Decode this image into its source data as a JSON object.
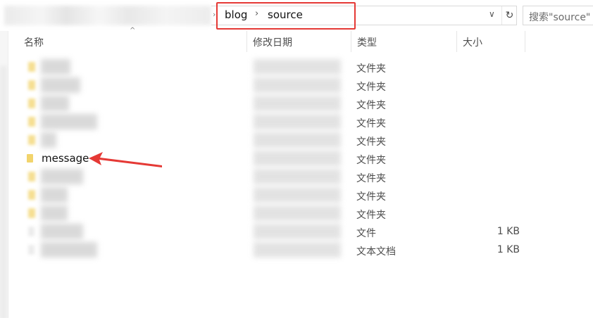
{
  "address_bar": {
    "path": [
      "blog",
      "source"
    ],
    "chevron": "›",
    "dropdown_icon": "chevron-down-icon",
    "refresh_icon": "refresh-icon"
  },
  "search": {
    "placeholder": "搜索\"source\""
  },
  "columns": {
    "name": "名称",
    "date": "修改日期",
    "type": "类型",
    "size": "大小"
  },
  "rows": [
    {
      "name": "",
      "type": "文件夹",
      "size": ""
    },
    {
      "name": "",
      "type": "文件夹",
      "size": ""
    },
    {
      "name": "",
      "type": "文件夹",
      "size": ""
    },
    {
      "name": "",
      "type": "文件夹",
      "size": ""
    },
    {
      "name": "",
      "type": "文件夹",
      "size": ""
    },
    {
      "name": "message",
      "type": "文件夹",
      "size": ""
    },
    {
      "name": "",
      "type": "文件夹",
      "size": ""
    },
    {
      "name": "",
      "type": "文件夹",
      "size": ""
    },
    {
      "name": "",
      "type": "文件夹",
      "size": ""
    },
    {
      "name": "",
      "type": "文件",
      "size": "1 KB"
    },
    {
      "name": "",
      "type": "文本文档",
      "size": "1 KB"
    }
  ],
  "colors": {
    "highlight_box": "#e53935",
    "arrow": "#e53935",
    "folder": "#f2d46c"
  }
}
